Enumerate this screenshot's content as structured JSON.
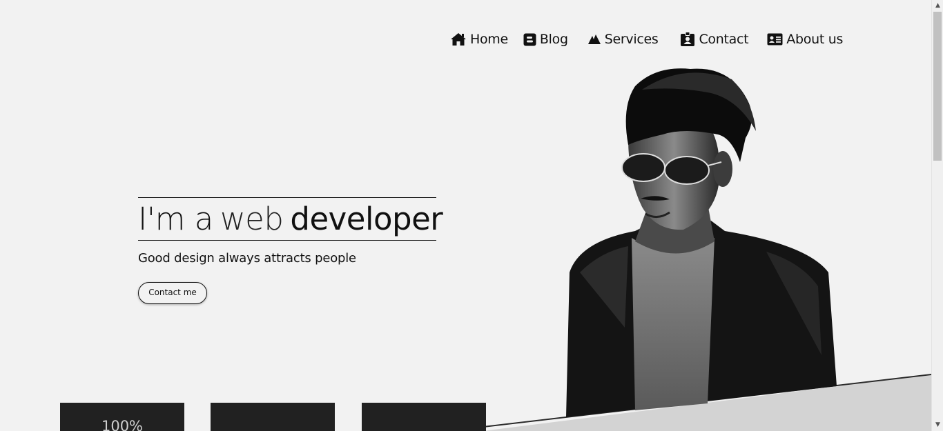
{
  "nav": {
    "items": [
      {
        "label": "Home",
        "icon": "home-icon"
      },
      {
        "label": "Blog",
        "icon": "blogger-icon"
      },
      {
        "label": "Services",
        "icon": "services-icon"
      },
      {
        "label": "Contact",
        "icon": "id-badge-icon"
      },
      {
        "label": "About us",
        "icon": "address-card-icon"
      }
    ]
  },
  "hero": {
    "headline_part1": "I'm a",
    "headline_part2": "web",
    "headline_part3": "developer",
    "tagline": "Good design always attracts people",
    "cta_label": "Contact me"
  },
  "cards": [
    {
      "value": "100%"
    },
    {
      "value": ""
    },
    {
      "value": ""
    }
  ],
  "colors": {
    "background": "#f2f2f2",
    "card": "#212121",
    "slope": "#d3d3d3"
  }
}
